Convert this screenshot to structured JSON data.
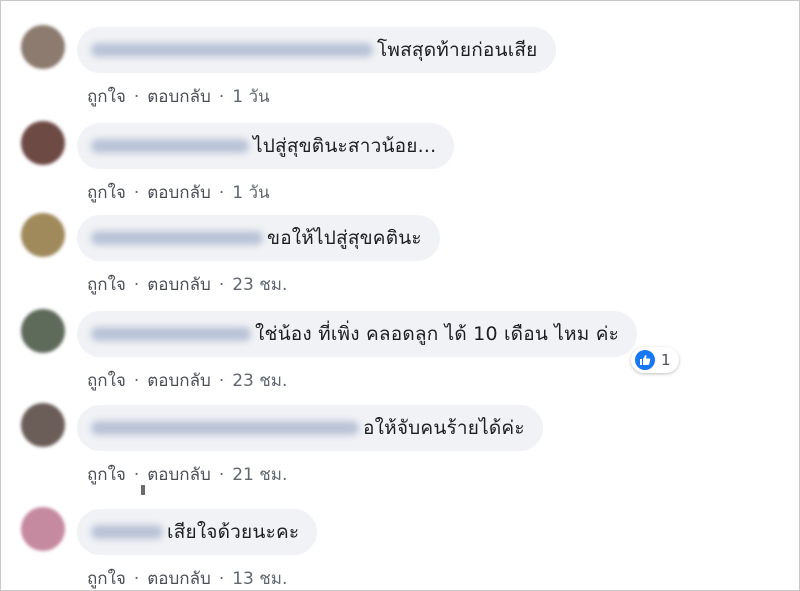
{
  "comments": [
    {
      "text": "โพสสุดท้ายก่อนเสีย",
      "like": "ถูกใจ",
      "reply": "ตอบกลับ",
      "time": "1 วัน",
      "avatar_color": "#8c7b6e"
    },
    {
      "text": "ไปสู่สุขตินะสาวน้อย...",
      "like": "ถูกใจ",
      "reply": "ตอบกลับ",
      "time": "1 วัน",
      "avatar_color": "#6e4a44"
    },
    {
      "text": "ขอให้ไปสู่สุขคตินะ",
      "like": "ถูกใจ",
      "reply": "ตอบกลับ",
      "time": "23 ชม.",
      "avatar_color": "#a08a5c"
    },
    {
      "text": "ใช่น้อง ที่เพิ่ง คลอดลูก ได้ 10 เดือน ไหม ค่ะ",
      "like": "ถูกใจ",
      "reply": "ตอบกลับ",
      "time": "23 ชม.",
      "avatar_color": "#5e6a5a",
      "reactions": {
        "count": "1",
        "icon": "like-icon",
        "color": "#1877f2"
      }
    },
    {
      "text": "อให้จับคนร้ายได้ค่ะ",
      "like": "ถูกใจ",
      "reply": "ตอบกลับ",
      "time": "21 ชม.",
      "avatar_color": "#6b5e58"
    },
    {
      "text": "เสียใจด้วยนะคะ",
      "like": "ถูกใจ",
      "reply": "ตอบกลับ",
      "time": "13 ชม.",
      "avatar_color": "#c58aa0"
    }
  ]
}
